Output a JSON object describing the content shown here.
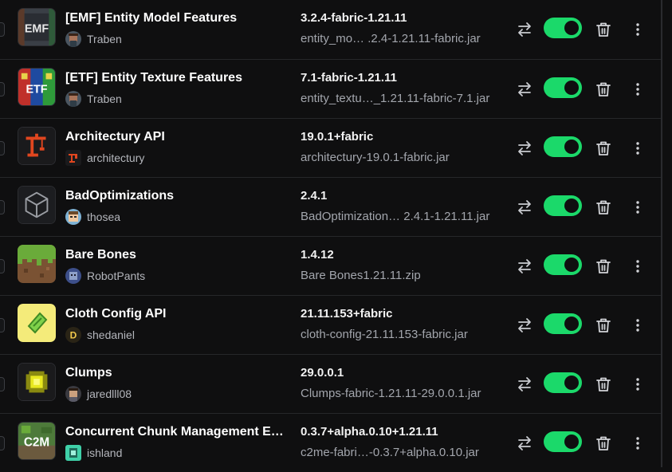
{
  "colors": {
    "accent": "#1bd96a",
    "background": "#0f0f10",
    "divider": "#26272a"
  },
  "mods": [
    {
      "name": "[EMF] Entity Model Features",
      "author": "Traben",
      "version": "3.2.4-fabric-1.21.11",
      "file": "entity_mo… .2.4-1.21.11-fabric.jar",
      "enabled": true,
      "icon": "emf-icon"
    },
    {
      "name": "[ETF] Entity Texture Features",
      "author": "Traben",
      "version": "7.1-fabric-1.21.11",
      "file": "entity_textu…_1.21.11-fabric-7.1.jar",
      "enabled": true,
      "icon": "etf-icon"
    },
    {
      "name": "Architectury API",
      "author": "architectury",
      "version": "19.0.1+fabric",
      "file": "architectury-19.0.1-fabric.jar",
      "enabled": true,
      "icon": "crane-icon"
    },
    {
      "name": "BadOptimizations",
      "author": "thosea",
      "version": "2.4.1",
      "file": "BadOptimization… 2.4.1-1.21.11.jar",
      "enabled": true,
      "icon": "cube-outline-icon"
    },
    {
      "name": "Bare Bones",
      "author": "RobotPants",
      "version": "1.4.12",
      "file": "Bare Bones1.21.11.zip",
      "enabled": true,
      "icon": "grass-block-icon"
    },
    {
      "name": "Cloth Config API",
      "author": "shedaniel",
      "version": "21.11.153+fabric",
      "file": "cloth-config-21.11.153-fabric.jar",
      "enabled": true,
      "icon": "cloth-icon"
    },
    {
      "name": "Clumps",
      "author": "jaredlll08",
      "version": "29.0.0.1",
      "file": "Clumps-fabric-1.21.11-29.0.0.1.jar",
      "enabled": true,
      "icon": "xp-orb-icon"
    },
    {
      "name": "Concurrent Chunk Management E…",
      "author": "ishland",
      "version": "0.3.7+alpha.0.10+1.21.11",
      "file": "c2me-fabri…-0.3.7+alpha.0.10.jar",
      "enabled": true,
      "icon": "c2me-icon"
    }
  ]
}
